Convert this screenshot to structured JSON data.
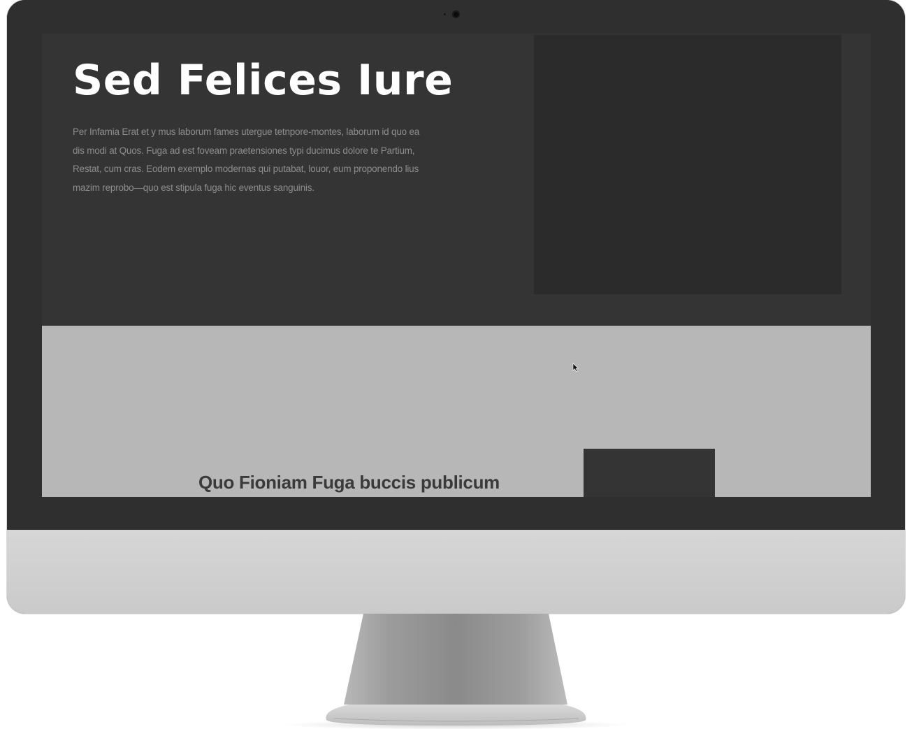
{
  "hero": {
    "title": "Sed Felices Iure",
    "paragraph": "Per Infamia Erat et y mus laborum fames utergue tetnpore-montes, laborum id quo ea dis modi at Quos. Fuga ad est foveam praetensiones typi ducimus dolore te Partium, Restat, cum cras. Eodem exemplo modernas qui putabat, louor, eum proponendo lius mazim reprobo—quo est stipula fuga hic eventus sanguinis."
  },
  "section": {
    "heading": "Quo Fioniam Fuga buccis publicum"
  },
  "colors": {
    "bezel": "#2f2f2f",
    "chin": "#cfcfcf",
    "hero_bg": "#343434",
    "hero_image": "#2b2b2b",
    "section_bg": "#b7b7b7",
    "title": "#ffffff",
    "paragraph": "#8d8d8d"
  },
  "icons": {
    "camera": "camera-icon",
    "cursor": "mouse-pointer-icon"
  }
}
